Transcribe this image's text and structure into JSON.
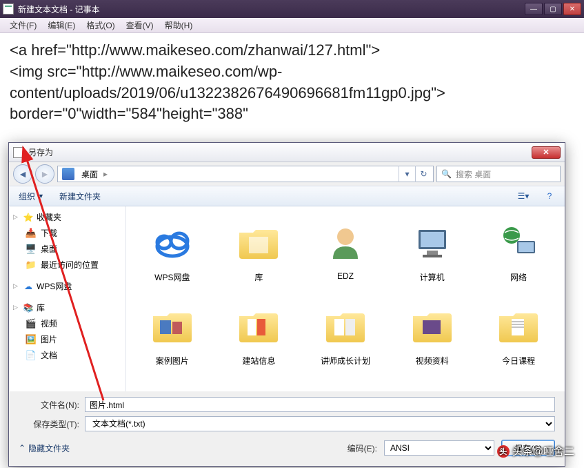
{
  "notepad": {
    "title": "新建文本文档 - 记事本",
    "menus": [
      "文件(F)",
      "编辑(E)",
      "格式(O)",
      "查看(V)",
      "帮助(H)"
    ],
    "content_lines": [
      "<a href=\"http://www.maikeseo.com/zhanwai/127.html\">",
      "<img src=\"http://www.maikeseo.com/wp-content/uploads/2019/06/u132238267649069668​1fm11gp0.jpg\">",
      "border=\"0\"width=\"584\"height=\"388\""
    ]
  },
  "dialog": {
    "title": "另存为",
    "breadcrumb": {
      "location": "桌面"
    },
    "search_placeholder": "搜索 桌面",
    "toolbar": {
      "organize": "组织",
      "new_folder": "新建文件夹"
    },
    "sidebar": {
      "favorites": {
        "label": "收藏夹",
        "items": [
          "下载",
          "桌面",
          "最近访问的位置"
        ]
      },
      "wps": {
        "label": "WPS网盘"
      },
      "libraries": {
        "label": "库",
        "items": [
          "视频",
          "图片",
          "文档"
        ]
      }
    },
    "files_row1": [
      {
        "name": "WPS网盘",
        "icon": "cloud"
      },
      {
        "name": "库",
        "icon": "folder-lib"
      },
      {
        "name": "EDZ",
        "icon": "user"
      },
      {
        "name": "计算机",
        "icon": "computer"
      },
      {
        "name": "网络",
        "icon": "network"
      }
    ],
    "files_row2": [
      {
        "name": "案例图片",
        "icon": "folder-pics"
      },
      {
        "name": "建站信息",
        "icon": "folder-docs"
      },
      {
        "name": "讲师成长计划",
        "icon": "folder-docs2"
      },
      {
        "name": "视频资料",
        "icon": "folder-video"
      },
      {
        "name": "今日课程",
        "icon": "folder-file"
      }
    ],
    "filename_label": "文件名(N):",
    "filename_value": "图片.html",
    "savetype_label": "保存类型(T):",
    "savetype_value": "文本文档(*.txt)",
    "hide_folders": "隐藏文件夹",
    "encoding_label": "编码(E):",
    "encoding_value": "ANSI",
    "save_btn": "保存(S)"
  },
  "watermark": "头条@哑舍二"
}
